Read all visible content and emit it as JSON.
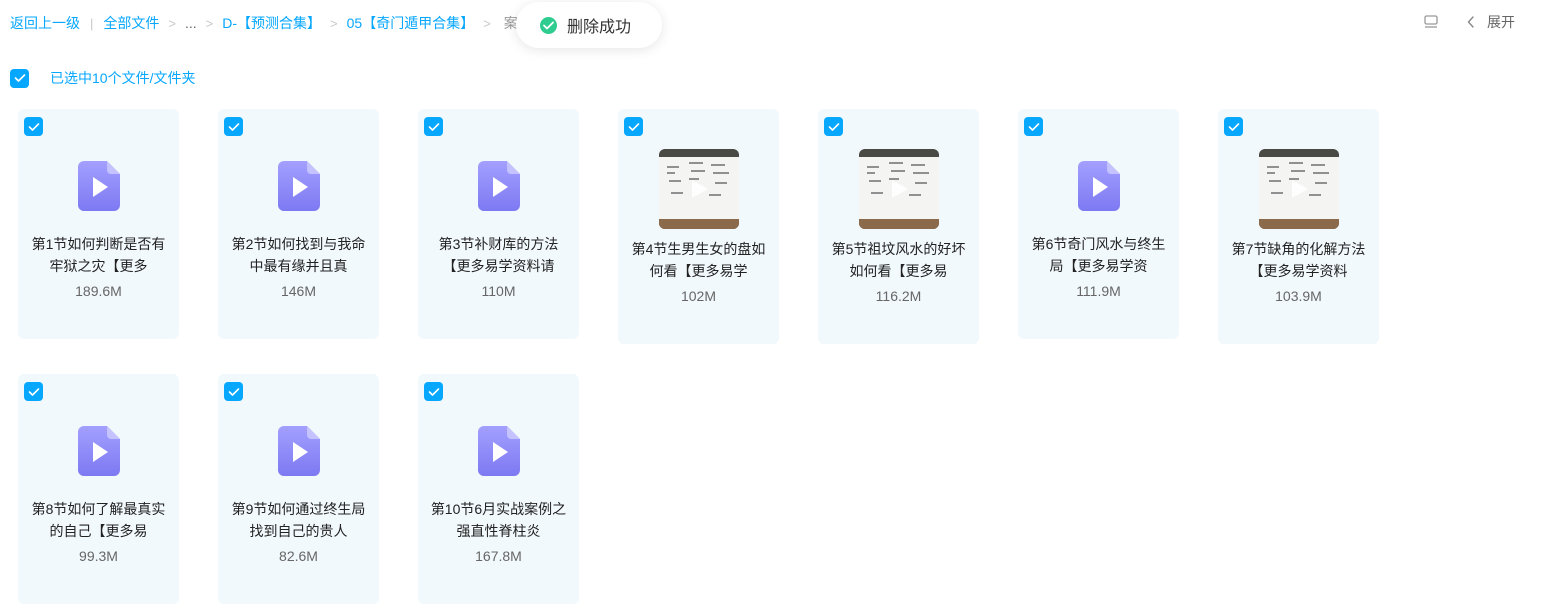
{
  "breadcrumb": {
    "back": "返回上一级",
    "all_files": "全部文件",
    "ellipsis": "...",
    "level1": "D-【预测合集】",
    "level2": "05【奇门遁甲合集】",
    "tail": "案..."
  },
  "toast": {
    "text": "删除成功",
    "color": "#2ecc8f"
  },
  "toolbar": {
    "expand_label": "展开"
  },
  "selection": {
    "text": "已选中10个文件/文件夹"
  },
  "accent_color": "#06a7ff",
  "files": [
    {
      "name": "第1节如何判断是否有牢狱之灾【更多",
      "size": "189.6M",
      "thumb": "video-file-icon",
      "checked": true
    },
    {
      "name": "第2节如何找到与我命中最有缘并且真",
      "size": "146M",
      "thumb": "video-file-icon",
      "checked": true
    },
    {
      "name": "第3节补财库的方法【更多易学资料请",
      "size": "110M",
      "thumb": "video-file-icon",
      "checked": true
    },
    {
      "name": "第4节生男生女的盘如何看【更多易学",
      "size": "102M",
      "thumb": "video-thumbnail",
      "checked": true
    },
    {
      "name": "第5节祖坟风水的好坏如何看【更多易",
      "size": "116.2M",
      "thumb": "video-thumbnail",
      "checked": true
    },
    {
      "name": "第6节奇门风水与终生局【更多易学资",
      "size": "111.9M",
      "thumb": "video-file-icon",
      "checked": true
    },
    {
      "name": "第7节缺角的化解方法【更多易学资料",
      "size": "103.9M",
      "thumb": "video-thumbnail",
      "checked": true
    },
    {
      "name": "第8节如何了解最真实的自己【更多易",
      "size": "99.3M",
      "thumb": "video-file-icon",
      "checked": true
    },
    {
      "name": "第9节如何通过终生局找到自己的贵人",
      "size": "82.6M",
      "thumb": "video-file-icon",
      "checked": true
    },
    {
      "name": "第10节6月实战案例之强直性脊柱炎",
      "size": "167.8M",
      "thumb": "video-file-icon",
      "checked": true
    }
  ]
}
